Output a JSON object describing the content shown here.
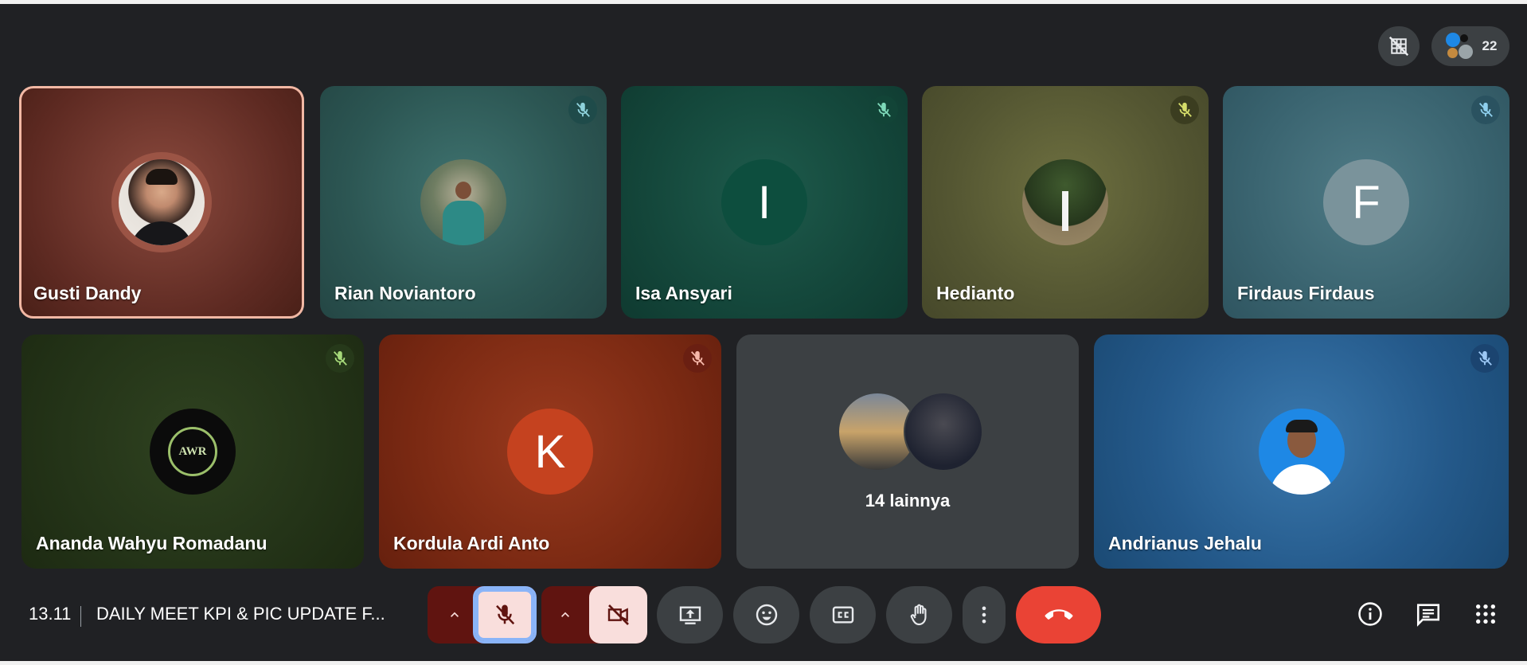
{
  "topbar": {
    "participants_count": "22"
  },
  "tiles_row1": [
    {
      "name": "Gusti Dandy"
    },
    {
      "name": "Rian Noviantoro"
    },
    {
      "name": "Isa Ansyari",
      "initial": "I"
    },
    {
      "name": "Hedianto"
    },
    {
      "name": "Firdaus Firdaus",
      "initial": "F"
    }
  ],
  "tiles_row2": [
    {
      "name": "Ananda Wahyu Romadanu",
      "logo_text": "AWR"
    },
    {
      "name": "Kordula Ardi Anto",
      "initial": "K"
    },
    {
      "others_label": "14 lainnya"
    },
    {
      "name": "Andrianus Jehalu"
    }
  ],
  "meeting": {
    "time": "13.11",
    "title": "DAILY MEET KPI & PIC UPDATE F..."
  },
  "icons": {
    "mic": "mic-off-icon",
    "camera": "videocam-off-icon",
    "present": "present-to-all-icon",
    "emoji": "emoji-icon",
    "captions": "closed-caption-icon",
    "hand": "raise-hand-icon",
    "more": "more-vert-icon",
    "leave": "call-end-icon",
    "info": "info-icon",
    "chat": "chat-icon",
    "activities": "apps-icon"
  },
  "colors": {
    "background": "#202124",
    "danger": "#ea4335",
    "active_tile_border": "#f2b8a4",
    "mic_selected_ring": "#8ab4f8",
    "off_button_bg": "#f9dedc",
    "caret_bg": "#601410"
  }
}
